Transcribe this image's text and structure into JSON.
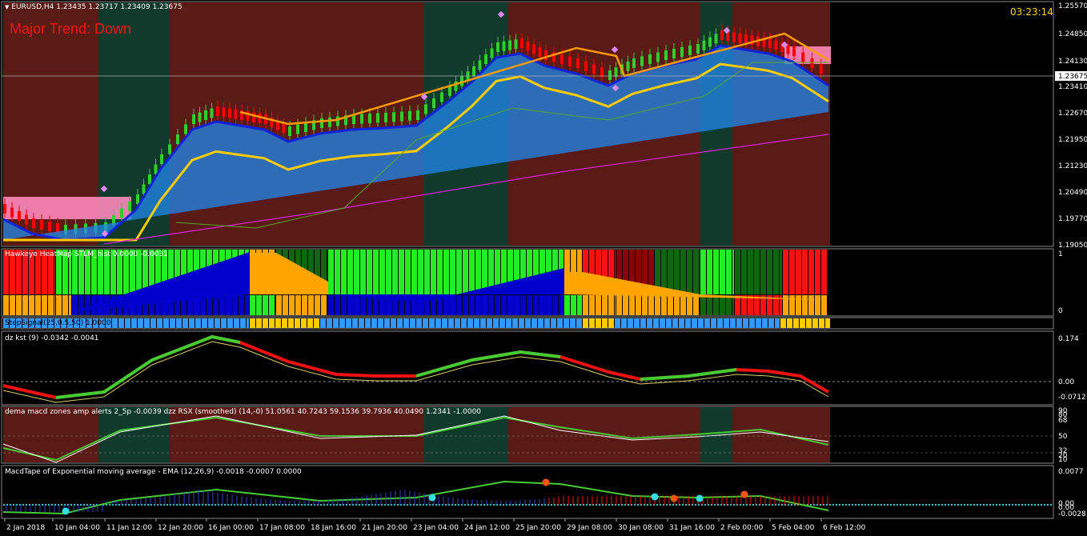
{
  "main": {
    "symbol_label": "EURUSD,H4  1.23435 1.23717 1.23409 1.23675",
    "trend_text": "Major Trend: Down",
    "timer": "03:23:14",
    "price_ticks": [
      "1.25570",
      "1.24850",
      "1.24130",
      "1.23410",
      "1.22670",
      "1.21950",
      "1.21230",
      "1.20490",
      "1.19770",
      "1.19050"
    ],
    "current_price": "1.23675"
  },
  "heatmap": {
    "label": "Hawkeye HeatMap  STLM_hist 0.0000 -0.0031",
    "ticks": [
      "1",
      "0"
    ]
  },
  "strip": {
    "label": "StepSignal(25,0.5,50) 1.0000"
  },
  "kst": {
    "label": "dz kst (9) -0.0342 -0.0041",
    "ticks": [
      "0.174",
      "0.00",
      "-0.0712"
    ]
  },
  "macd_zones": {
    "label": "dema macd zones amp alerts 2_5p -0.0039  dzz  RSX (smoothed) (14,-0) 51.0561 40.7243 59.1536 39.7936 40.0490 1.2341 -1.0000",
    "ticks": [
      "90",
      "80",
      "68",
      "50",
      "32",
      "20",
      "10"
    ]
  },
  "macd_tape": {
    "label": "MacdTape of Exponential moving average - EMA (12,26,9) -0.0018 -0.0007 0.0000",
    "ticks": [
      "0.0077",
      "0.00",
      "0.00",
      "-0.0028"
    ]
  },
  "time_axis": [
    "2 Jan 2018",
    "10 Jan 04:00",
    "11 Jan 12:00",
    "12 Jan 20:00",
    "16 Jan 00:00",
    "17 Jan 08:00",
    "18 Jan 16:00",
    "21 Jan 20:00",
    "23 Jan 04:00",
    "24 Jan 12:00",
    "25 Jan 20:00",
    "29 Jan 08:00",
    "30 Jan 08:00",
    "31 Jan 16:00",
    "2 Feb 00:00",
    "5 Feb 04:00",
    "6 Feb 12:00"
  ],
  "colors": {
    "bear_zone": "#5a1a16",
    "bull_zone": "#0f3a2c",
    "heat_lime": "#22ee22",
    "heat_green": "#116611",
    "heat_orange": "#ffa500",
    "heat_red": "#ff1111",
    "heat_darkred": "#8b0000",
    "heat_blue": "#0000cc",
    "strip_blue": "#3399ff",
    "strip_yellow": "#ffcc00"
  },
  "icons": {
    "menu": "triangle-down-icon"
  }
}
